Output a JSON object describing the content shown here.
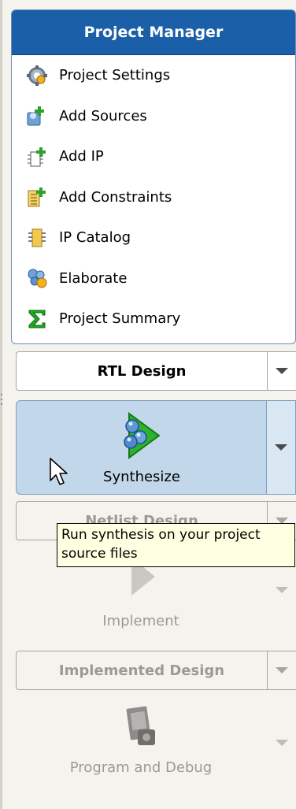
{
  "project_manager": {
    "title": "Project Manager",
    "items": [
      {
        "label": "Project Settings",
        "icon": "gear-icon"
      },
      {
        "label": "Add Sources",
        "icon": "add-sources-icon"
      },
      {
        "label": "Add IP",
        "icon": "add-ip-icon"
      },
      {
        "label": "Add Constraints",
        "icon": "add-constraints-icon"
      },
      {
        "label": "IP Catalog",
        "icon": "ip-catalog-icon"
      },
      {
        "label": "Elaborate",
        "icon": "elaborate-icon"
      },
      {
        "label": "Project Summary",
        "icon": "sigma-icon"
      }
    ]
  },
  "flow": {
    "rtl_design": "RTL Design",
    "synthesize": "Synthesize",
    "netlist_design": "Netlist Design",
    "implement": "Implement",
    "implemented_design": "Implemented Design",
    "program_and_debug": "Program and Debug"
  },
  "tooltip": {
    "line1": "Run synthesis on your project",
    "line2": "source files"
  },
  "colors": {
    "header_blue": "#1b5fa8",
    "active_blue": "#c2d8ea",
    "tooltip_bg": "#ffffe1",
    "synth_green": "#2fb02f",
    "disabled_text": "#9b9a96"
  }
}
